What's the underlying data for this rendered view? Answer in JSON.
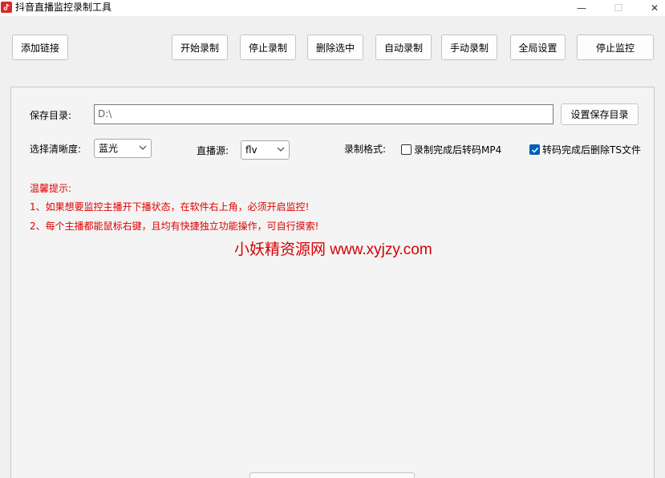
{
  "window": {
    "title": "抖音直播监控录制工具",
    "controls": {
      "minimize": "—",
      "maximize": "☐",
      "close": "✕"
    }
  },
  "toolbar": {
    "add_link": "添加链接",
    "start_record": "开始录制",
    "stop_record": "停止录制",
    "delete_selected": "删除选中",
    "auto_record": "自动录制",
    "manual_record": "手动录制",
    "global_settings": "全局设置",
    "stop_monitor": "停止监控"
  },
  "settings": {
    "save_dir_label": "保存目录:",
    "save_dir_value": "D:\\",
    "set_save_dir_button": "设置保存目录",
    "quality_label": "选择清晰度:",
    "quality_value": "蓝光",
    "source_label": "直播源:",
    "source_value": "flv",
    "format_label": "录制格式:",
    "convert_mp4_label": "录制完成后转码MP4",
    "convert_mp4_checked": false,
    "delete_ts_label": "转码完成后删除TS文件",
    "delete_ts_checked": true
  },
  "tips": {
    "title": "温馨提示:",
    "line1": "1、如果想要监控主播开下播状态，在软件右上角，必须开启监控!",
    "line2": "2、每个主播都能鼠标右键，且均有快捷独立功能操作，可自行摸索!"
  },
  "watermark": "小妖精资源网 www.xyjzy.com",
  "colors": {
    "tip_text": "#e00000",
    "checkbox_checked": "#005fb8",
    "app_icon": "#d52b2b"
  },
  "icons": {
    "app": "app-logo-icon",
    "dropdown": "chevron-down-icon",
    "check": "checkmark-icon"
  }
}
